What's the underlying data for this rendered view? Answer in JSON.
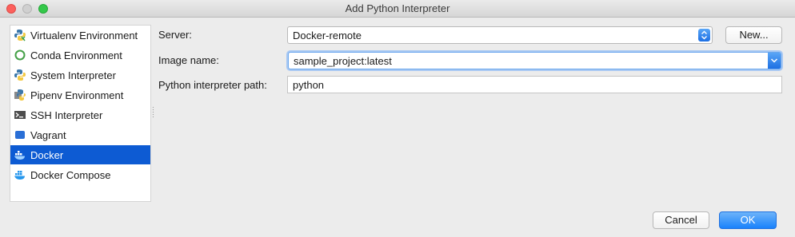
{
  "window": {
    "title": "Add Python Interpreter"
  },
  "sidebar": {
    "items": [
      {
        "label": "Virtualenv Environment",
        "icon": "virtualenv-icon"
      },
      {
        "label": "Conda Environment",
        "icon": "conda-icon"
      },
      {
        "label": "System Interpreter",
        "icon": "python-icon"
      },
      {
        "label": "Pipenv Environment",
        "icon": "pipenv-icon"
      },
      {
        "label": "SSH Interpreter",
        "icon": "terminal-icon"
      },
      {
        "label": "Vagrant",
        "icon": "vagrant-icon"
      },
      {
        "label": "Docker",
        "icon": "docker-icon",
        "selected": true
      },
      {
        "label": "Docker Compose",
        "icon": "docker-compose-icon"
      }
    ]
  },
  "form": {
    "server_label": "Server:",
    "server_value": "Docker-remote",
    "new_button": "New...",
    "image_label": "Image name:",
    "image_value": "sample_project:latest",
    "path_label": "Python interpreter path:",
    "path_value": "python"
  },
  "footer": {
    "cancel": "Cancel",
    "ok": "OK"
  },
  "colors": {
    "selection": "#0d5bd3",
    "accent": "#1a82fb"
  }
}
